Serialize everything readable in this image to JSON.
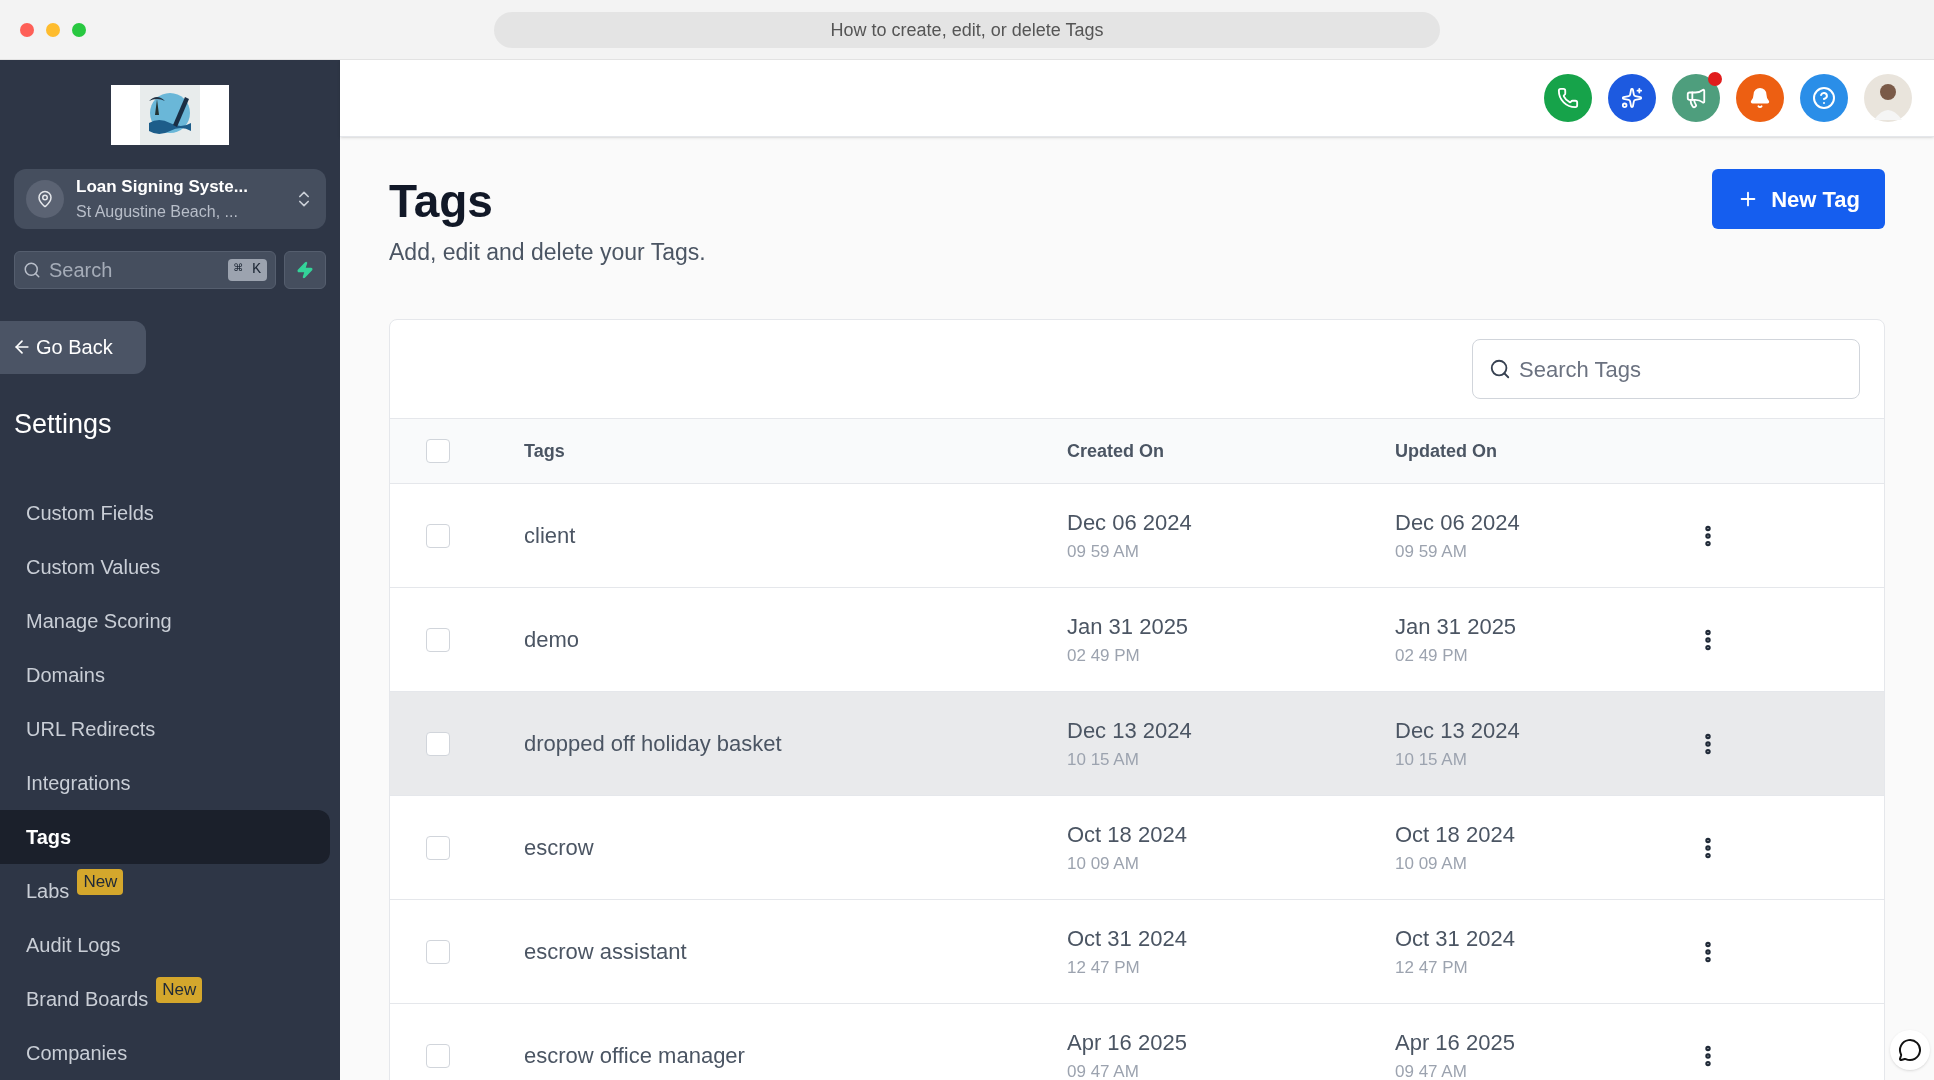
{
  "window": {
    "title": "How to create, edit, or delete Tags"
  },
  "sidebar": {
    "account": {
      "name": "Loan Signing Syste...",
      "location": "St Augustine Beach, ..."
    },
    "search": {
      "placeholder": "Search",
      "shortcut": "⌘ K"
    },
    "back_button": "Go Back",
    "section_title": "Settings",
    "items": [
      {
        "label": "Custom Fields",
        "selected": false
      },
      {
        "label": "Custom Values",
        "selected": false
      },
      {
        "label": "Manage Scoring",
        "selected": false
      },
      {
        "label": "Domains",
        "selected": false
      },
      {
        "label": "URL Redirects",
        "selected": false
      },
      {
        "label": "Integrations",
        "selected": false
      },
      {
        "label": "Tags",
        "selected": true
      },
      {
        "label": "Labs",
        "selected": false,
        "badge": "New"
      },
      {
        "label": "Audit Logs",
        "selected": false
      },
      {
        "label": "Brand Boards",
        "selected": false,
        "badge": "New"
      },
      {
        "label": "Companies",
        "selected": false
      }
    ]
  },
  "header": {
    "notification_dot": true
  },
  "page": {
    "title": "Tags",
    "subtitle": "Add, edit and delete your Tags.",
    "new_button": "New Tag"
  },
  "table": {
    "search": {
      "placeholder": "Search Tags"
    },
    "select_all_checked": false,
    "columns": [
      "Tags",
      "Created On",
      "Updated On"
    ],
    "rows": [
      {
        "name": "client",
        "created_date": "Dec 06 2024",
        "created_time": "09 59 AM",
        "updated_date": "Dec 06 2024",
        "updated_time": "09 59 AM",
        "highlighted": false
      },
      {
        "name": "demo",
        "created_date": "Jan 31 2025",
        "created_time": "02 49 PM",
        "updated_date": "Jan 31 2025",
        "updated_time": "02 49 PM",
        "highlighted": false
      },
      {
        "name": "dropped off holiday basket",
        "created_date": "Dec 13 2024",
        "created_time": "10 15 AM",
        "updated_date": "Dec 13 2024",
        "updated_time": "10 15 AM",
        "highlighted": true
      },
      {
        "name": "escrow",
        "created_date": "Oct 18 2024",
        "created_time": "10 09 AM",
        "updated_date": "Oct 18 2024",
        "updated_time": "10 09 AM",
        "highlighted": false
      },
      {
        "name": "escrow assistant",
        "created_date": "Oct 31 2024",
        "created_time": "12 47 PM",
        "updated_date": "Oct 31 2024",
        "updated_time": "12 47 PM",
        "highlighted": false
      },
      {
        "name": "escrow office manager",
        "created_date": "Apr 16 2025",
        "created_time": "09 47 AM",
        "updated_date": "Apr 16 2025",
        "updated_time": "09 47 AM",
        "highlighted": false
      }
    ]
  }
}
